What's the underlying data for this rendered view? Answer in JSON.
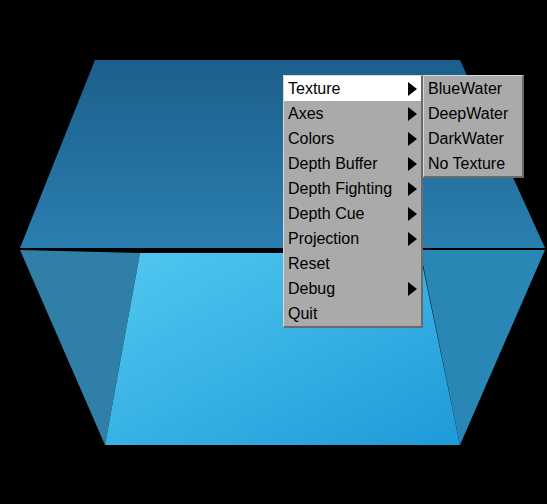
{
  "scene": {
    "kind": "textured-cube"
  },
  "menu": {
    "items": [
      {
        "label": "Texture",
        "submenu": true,
        "selected": true
      },
      {
        "label": "Axes",
        "submenu": true,
        "selected": false
      },
      {
        "label": "Colors",
        "submenu": true,
        "selected": false
      },
      {
        "label": "Depth Buffer",
        "submenu": true,
        "selected": false
      },
      {
        "label": "Depth Fighting",
        "submenu": true,
        "selected": false
      },
      {
        "label": "Depth Cue",
        "submenu": true,
        "selected": false
      },
      {
        "label": "Projection",
        "submenu": true,
        "selected": false
      },
      {
        "label": "Reset",
        "submenu": false,
        "selected": false
      },
      {
        "label": "Debug",
        "submenu": true,
        "selected": false
      },
      {
        "label": "Quit",
        "submenu": false,
        "selected": false
      }
    ]
  },
  "submenu": {
    "items": [
      {
        "label": "BlueWater",
        "selected": false
      },
      {
        "label": "DeepWater",
        "selected": false
      },
      {
        "label": "DarkWater",
        "selected": false
      },
      {
        "label": "No Texture",
        "selected": false
      }
    ]
  }
}
